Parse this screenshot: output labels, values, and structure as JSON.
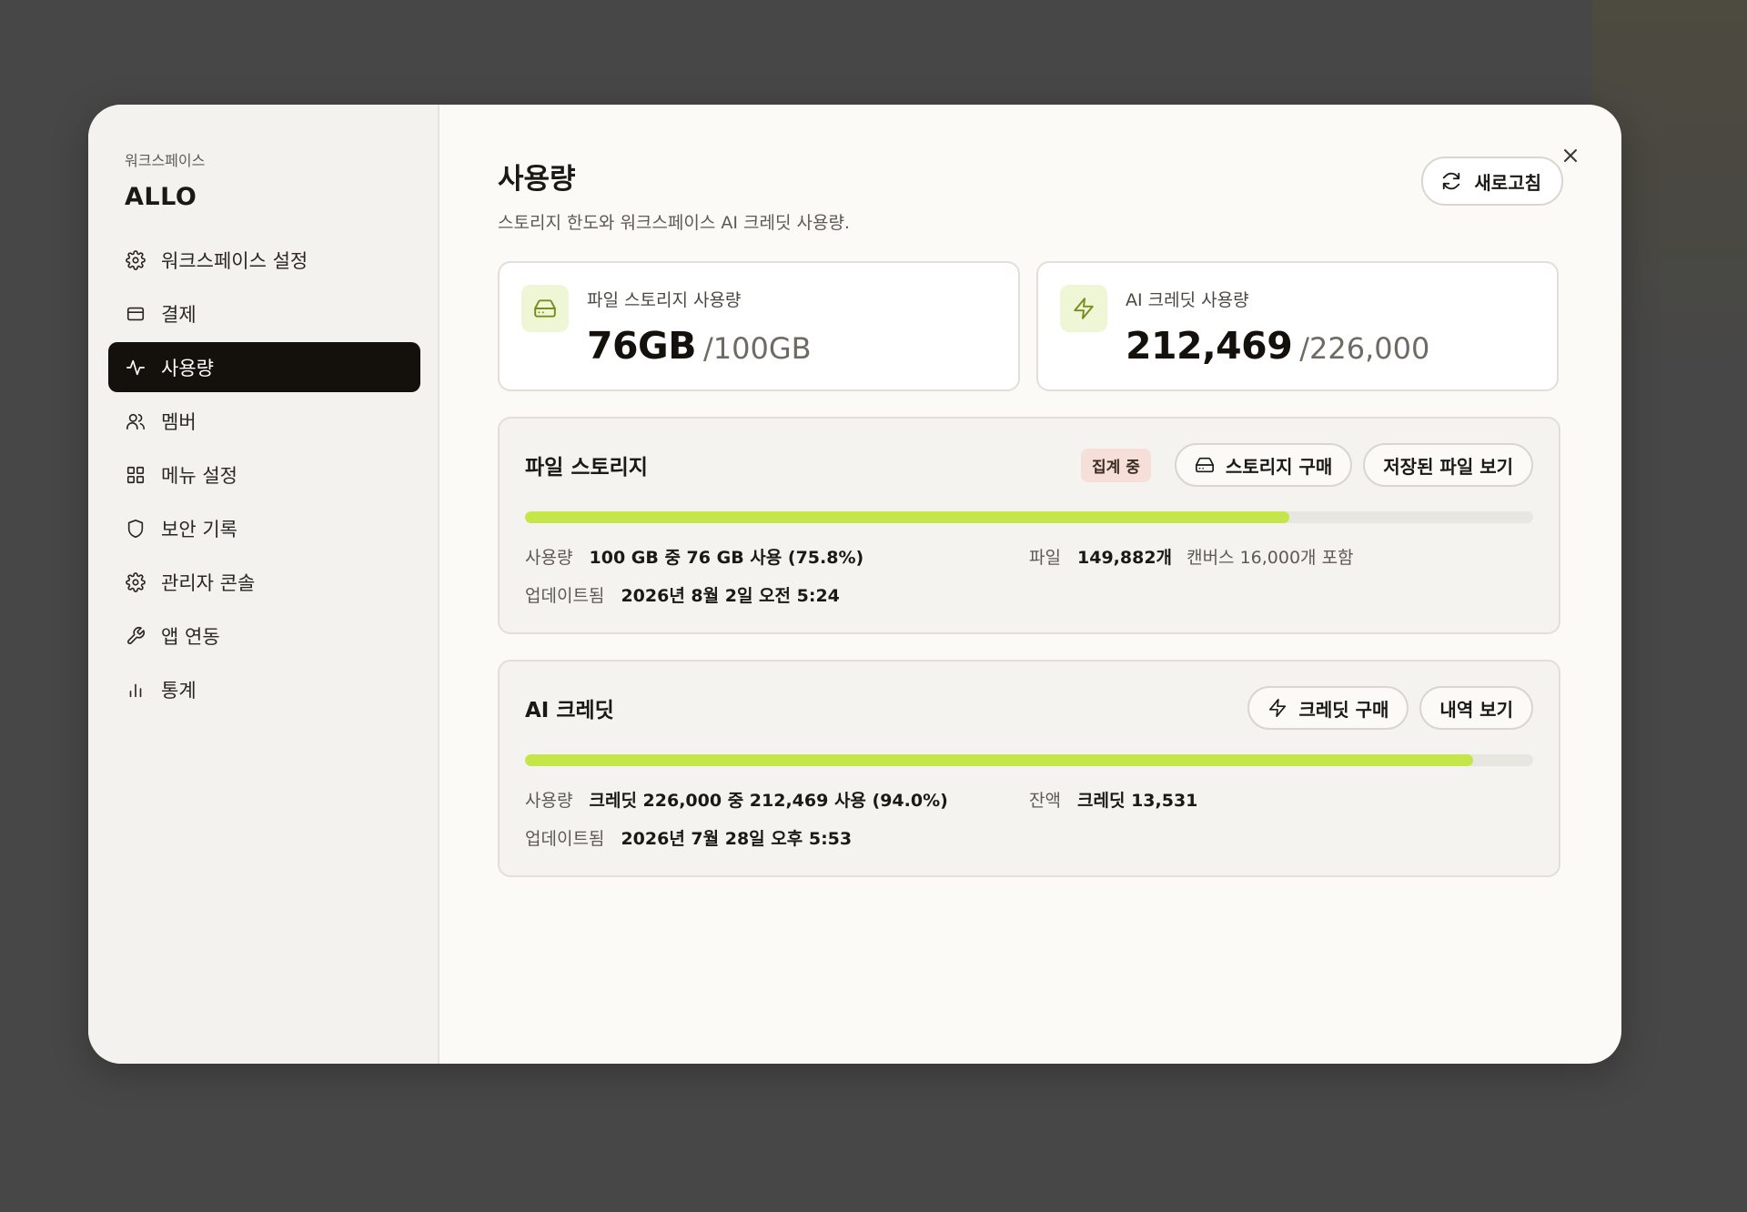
{
  "sidebar": {
    "workspace_caption": "워크스페이스",
    "workspace_name": "ALLO",
    "items": [
      {
        "label": "워크스페이스 설정",
        "icon": "gear-icon"
      },
      {
        "label": "결제",
        "icon": "credit-card-icon"
      },
      {
        "label": "사용량",
        "icon": "activity-icon",
        "active": true
      },
      {
        "label": "멤버",
        "icon": "users-icon"
      },
      {
        "label": "메뉴 설정",
        "icon": "grid-icon"
      },
      {
        "label": "보안 기록",
        "icon": "shield-icon"
      },
      {
        "label": "관리자 콘솔",
        "icon": "gear-icon"
      },
      {
        "label": "앱 연동",
        "icon": "wrench-icon"
      },
      {
        "label": "통계",
        "icon": "bar-chart-icon"
      }
    ]
  },
  "header": {
    "title": "사용량",
    "subtitle": "스토리지 한도와 워크스페이스 AI 크레딧 사용량.",
    "refresh_label": "새로고침"
  },
  "stats": {
    "storage": {
      "label": "파일 스토리지 사용량",
      "value": "76GB",
      "limit": "/100GB"
    },
    "credits": {
      "label": "AI 크레딧 사용량",
      "value": "212,469",
      "limit": "/226,000"
    }
  },
  "storage_panel": {
    "title": "파일 스토리지",
    "badge": "집계 중",
    "buy_label": "스토리지 구매",
    "view_label": "저장된 파일 보기",
    "progress": 0.758,
    "usage_key": "사용량",
    "usage_val": "100 GB 중 76 GB 사용 (75.8%)",
    "files_key": "파일",
    "files_val": "149,882개",
    "files_note": "캔버스 16,000개 포함",
    "updated_key": "업데이트됨",
    "updated_val": "2026년 8월 2일 오전 5:24"
  },
  "credit_panel": {
    "title": "AI 크레딧",
    "buy_label": "크레딧 구매",
    "history_label": "내역 보기",
    "progress": 0.94,
    "usage_key": "사용량",
    "usage_val": "크레딧 226,000 중 212,469 사용 (94.0%)",
    "balance_key": "잔액",
    "balance_val": "크레딧 13,531",
    "updated_key": "업데이트됨",
    "updated_val": "2026년 7월 28일 오후 5:53"
  },
  "colors": {
    "accent": "#c4e649",
    "active_nav": "#14110d",
    "badge_bg": "#f6dfd8",
    "icon_tile": "#eef6d6"
  }
}
